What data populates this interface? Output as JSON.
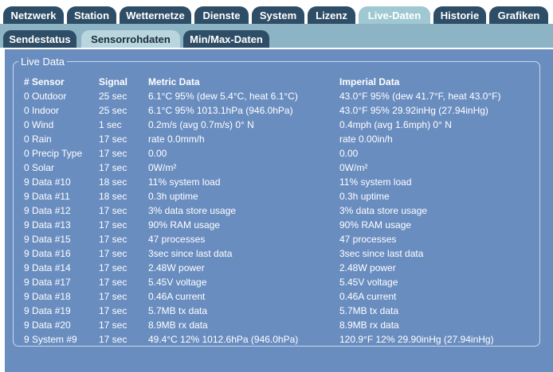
{
  "top_tabs": [
    {
      "label": "Netzwerk",
      "active": false
    },
    {
      "label": "Station",
      "active": false
    },
    {
      "label": "Wetternetze",
      "active": false
    },
    {
      "label": "Dienste",
      "active": false
    },
    {
      "label": "System",
      "active": false
    },
    {
      "label": "Lizenz",
      "active": false
    },
    {
      "label": "Live-Daten",
      "active": true
    },
    {
      "label": "Historie",
      "active": false
    },
    {
      "label": "Grafiken",
      "active": false
    }
  ],
  "sub_tabs": [
    {
      "label": "Sendestatus",
      "active": false
    },
    {
      "label": "Sensorrohdaten",
      "active": true
    },
    {
      "label": "Min/Max-Daten",
      "active": false
    }
  ],
  "panel": {
    "legend": "Live Data",
    "headers": {
      "sensor": "# Sensor",
      "signal": "Signal",
      "metric": "Metric Data",
      "imperial": "Imperial Data"
    },
    "rows": [
      {
        "sensor": "0 Outdoor",
        "signal": "25 sec",
        "metric": "6.1°C 95% (dew 5.4°C, heat 6.1°C)",
        "imperial": "43.0°F 95% (dew 41.7°F, heat 43.0°F)"
      },
      {
        "sensor": "0 Indoor",
        "signal": "25 sec",
        "metric": "6.1°C 95% 1013.1hPa (946.0hPa)",
        "imperial": "43.0°F 95% 29.92inHg (27.94inHg)"
      },
      {
        "sensor": "0 Wind",
        "signal": "1 sec",
        "metric": "0.2m/s (avg 0.7m/s) 0° N",
        "imperial": "0.4mph (avg 1.6mph) 0° N"
      },
      {
        "sensor": "0 Rain",
        "signal": "17 sec",
        "metric": "rate 0.0mm/h",
        "imperial": "rate 0.00in/h"
      },
      {
        "sensor": "0 Precip Type",
        "signal": "17 sec",
        "metric": "0.00",
        "imperial": "0.00"
      },
      {
        "sensor": "0 Solar",
        "signal": "17 sec",
        "metric": "0W/m²",
        "imperial": "0W/m²"
      },
      {
        "sensor": "9 Data #10",
        "signal": "18 sec",
        "metric": "11% system load",
        "imperial": "11% system load"
      },
      {
        "sensor": "9 Data #11",
        "signal": "18 sec",
        "metric": "0.3h uptime",
        "imperial": "0.3h uptime"
      },
      {
        "sensor": "9 Data #12",
        "signal": "17 sec",
        "metric": "3% data store usage",
        "imperial": "3% data store usage"
      },
      {
        "sensor": "9 Data #13",
        "signal": "17 sec",
        "metric": "90% RAM usage",
        "imperial": "90% RAM usage"
      },
      {
        "sensor": "9 Data #15",
        "signal": "17 sec",
        "metric": "47 processes",
        "imperial": "47 processes"
      },
      {
        "sensor": "9 Data #16",
        "signal": "17 sec",
        "metric": "3sec since last data",
        "imperial": "3sec since last data"
      },
      {
        "sensor": "9 Data #14",
        "signal": "17 sec",
        "metric": "2.48W power",
        "imperial": "2.48W power"
      },
      {
        "sensor": "9 Data #17",
        "signal": "17 sec",
        "metric": "5.45V voltage",
        "imperial": "5.45V voltage"
      },
      {
        "sensor": "9 Data #18",
        "signal": "17 sec",
        "metric": "0.46A current",
        "imperial": "0.46A current"
      },
      {
        "sensor": "9 Data #19",
        "signal": "17 sec",
        "metric": "5.7MB tx data",
        "imperial": "5.7MB tx data"
      },
      {
        "sensor": "9 Data #20",
        "signal": "17 sec",
        "metric": "8.9MB rx data",
        "imperial": "8.9MB rx data"
      },
      {
        "sensor": "9 System #9",
        "signal": "17 sec",
        "metric": "49.4°C 12% 1012.6hPa (946.0hPa)",
        "imperial": "120.9°F 12% 29.90inHg (27.94inHg)"
      }
    ]
  },
  "colors": {
    "tab_dark": "#2e4d66",
    "tab_active": "#9fc8d3",
    "sub_strip": "#8db4c4",
    "panel_bg": "#6a8dc0"
  }
}
